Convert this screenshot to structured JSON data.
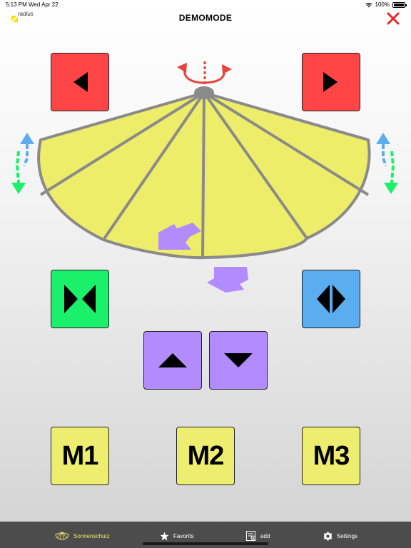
{
  "status": {
    "time": "5:13 PM",
    "date": "Wed Apr 22",
    "battery": "100%"
  },
  "header": {
    "logo_text": "radius",
    "title": "DEMOMODE"
  },
  "controls": {
    "rotate_left": "rotate-left",
    "rotate_right": "rotate-right",
    "close": "close",
    "tilt_up": "tilt-up",
    "tilt_down": "tilt-down",
    "close_umbrella": "close-umbrella",
    "open_umbrella": "open-umbrella"
  },
  "memory": {
    "m1": "M1",
    "m2": "M2",
    "m3": "M3"
  },
  "tabs": [
    {
      "label": "Sonnenschutz",
      "icon": "umbrella-icon",
      "active": true
    },
    {
      "label": "Favorits",
      "icon": "star-icon",
      "active": false
    },
    {
      "label": "add",
      "icon": "add-list-icon",
      "active": false
    },
    {
      "label": "Settings",
      "icon": "gear-icon",
      "active": false
    }
  ],
  "colors": {
    "red": "#ff4545",
    "green": "#1af06a",
    "blue": "#5aaef0",
    "purple": "#b28bff",
    "yellow": "#eded70",
    "canopy": "#eded6a",
    "tabbar": "#4c4c4c"
  }
}
